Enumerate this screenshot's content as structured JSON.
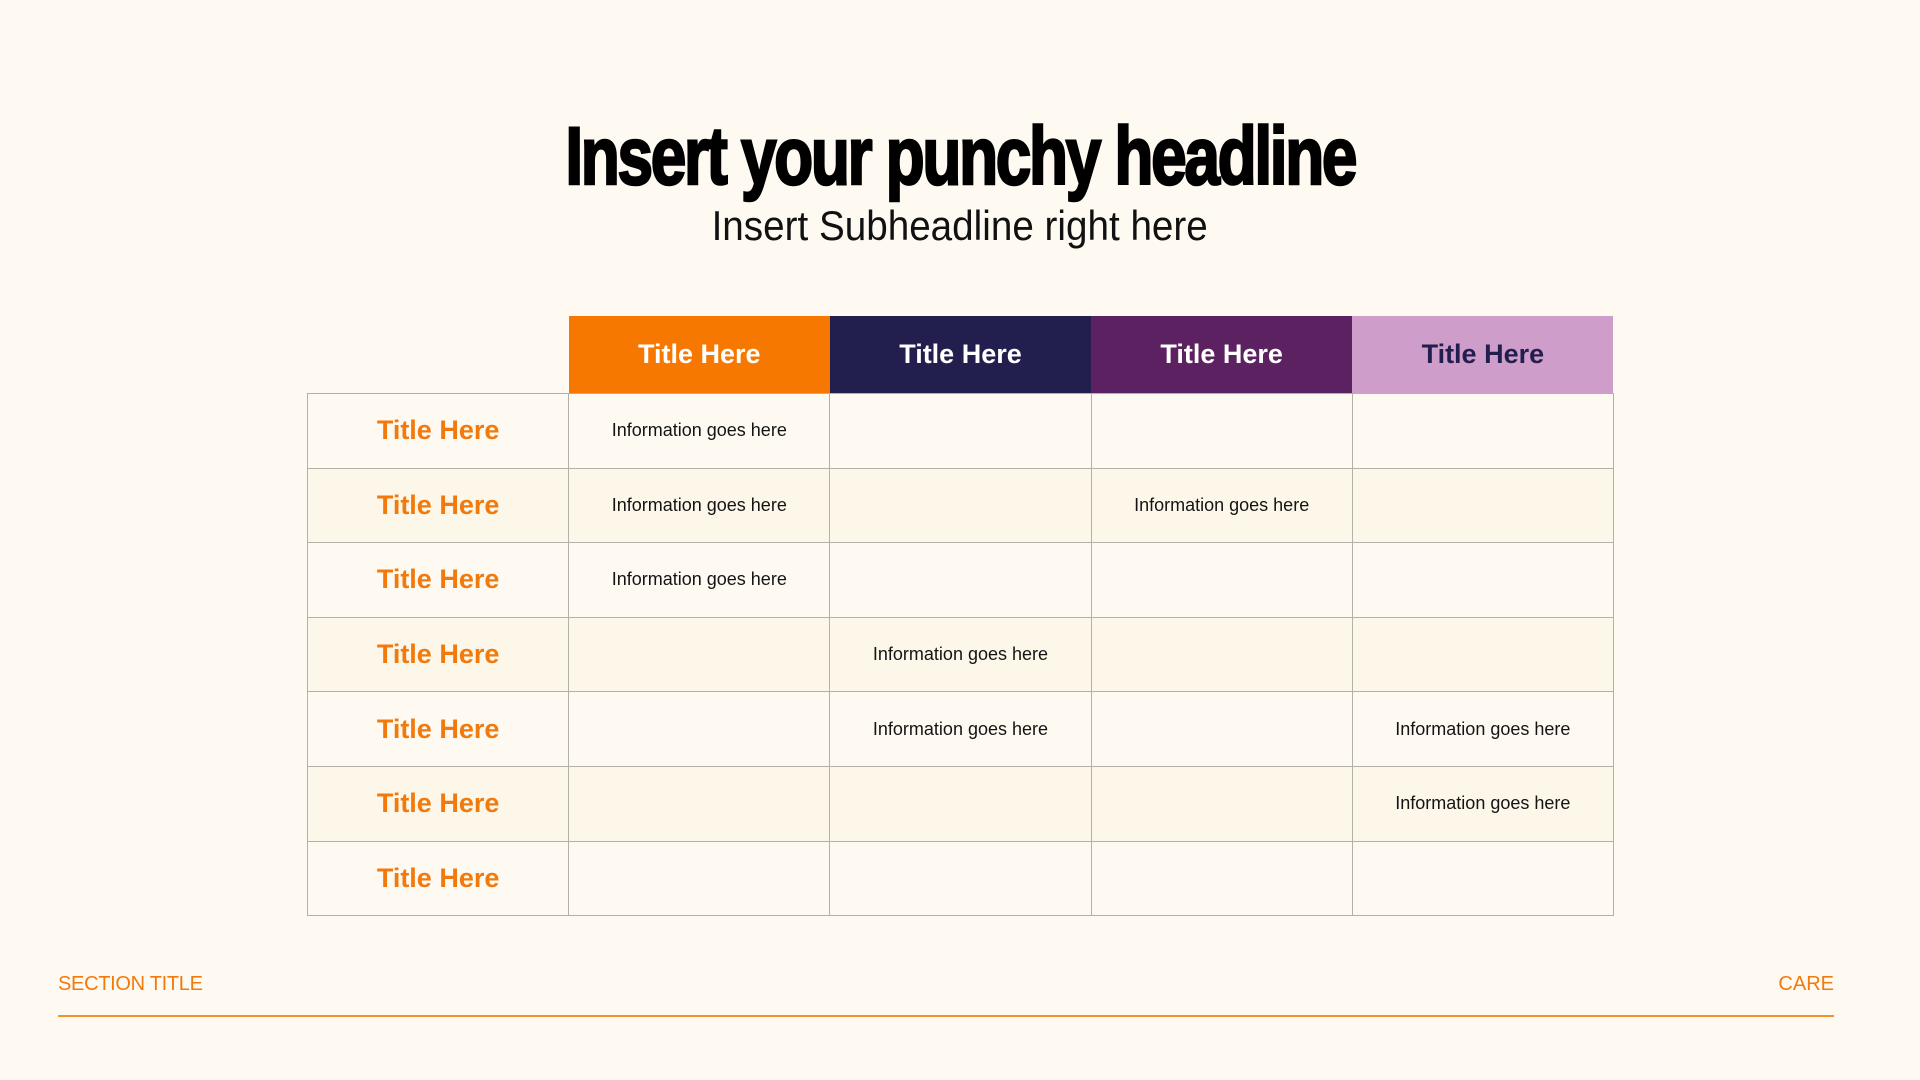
{
  "headline": "Insert your punchy headline",
  "subheadline": "Insert Subheadline right here",
  "colors": {
    "background": "#fefaf2",
    "accent_orange": "#f77800",
    "navy": "#221e4e",
    "purple": "#5c2161",
    "lilac": "#cf9dca",
    "row_label": "#f27a0c"
  },
  "table": {
    "columns": [
      {
        "label": "Title Here",
        "bg": "#f77800",
        "fg": "#ffffff"
      },
      {
        "label": "Title Here",
        "bg": "#221e4e",
        "fg": "#ffffff"
      },
      {
        "label": "Title Here",
        "bg": "#5c2161",
        "fg": "#ffffff"
      },
      {
        "label": "Title Here",
        "bg": "#cf9dca",
        "fg": "#221e4e"
      }
    ],
    "rows": [
      {
        "label": "Title Here",
        "cells": [
          "Information goes here",
          "",
          "",
          ""
        ]
      },
      {
        "label": "Title Here",
        "cells": [
          "Information goes here",
          "",
          "Information goes here",
          ""
        ]
      },
      {
        "label": "Title Here",
        "cells": [
          "Information goes here",
          "",
          "",
          ""
        ]
      },
      {
        "label": "Title Here",
        "cells": [
          "",
          "Information goes here",
          "",
          ""
        ]
      },
      {
        "label": "Title Here",
        "cells": [
          "",
          "Information goes here",
          "",
          "Information goes here"
        ]
      },
      {
        "label": "Title Here",
        "cells": [
          "",
          "",
          "",
          "Information goes here"
        ]
      },
      {
        "label": "Title Here",
        "cells": [
          "",
          "",
          "",
          ""
        ]
      }
    ]
  },
  "footer": {
    "section_title": "SECTION TITLE",
    "brand": "CARE"
  }
}
